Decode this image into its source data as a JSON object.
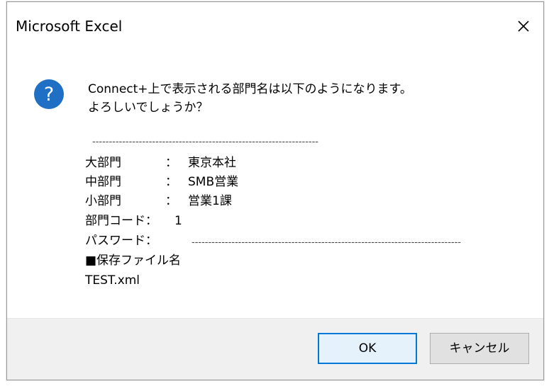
{
  "window": {
    "title": "Microsoft Excel",
    "close_symbol": "✕"
  },
  "message": {
    "line1": "Connect+上で表示される部門名は以下のようになります。",
    "line2": "よろしいでしょうか？"
  },
  "details": {
    "separator": "--------------------------------------------------------------------",
    "rows": [
      {
        "label": "大部門",
        "colon": "：",
        "value": "東京本社"
      },
      {
        "label": "中部門",
        "colon": "：",
        "value": "SMB営業"
      },
      {
        "label": "小部門",
        "colon": "：",
        "value": "営業1課"
      }
    ],
    "dept_code_label": "部門コード：",
    "dept_code_value": "1",
    "password_label": "パスワード：",
    "password_value": "---------------------------------------------------------------------------------",
    "save_file_label": "■保存ファイル名",
    "save_file_value": "TEST.xml"
  },
  "buttons": {
    "ok": "OK",
    "cancel": "キャンセル"
  },
  "colors": {
    "icon_blue": "#1f6fc4",
    "ok_border": "#0078d7",
    "footer_bg": "#f0f0f0"
  },
  "icons": {
    "dialog_icon": "question-icon",
    "close": "close-icon"
  }
}
